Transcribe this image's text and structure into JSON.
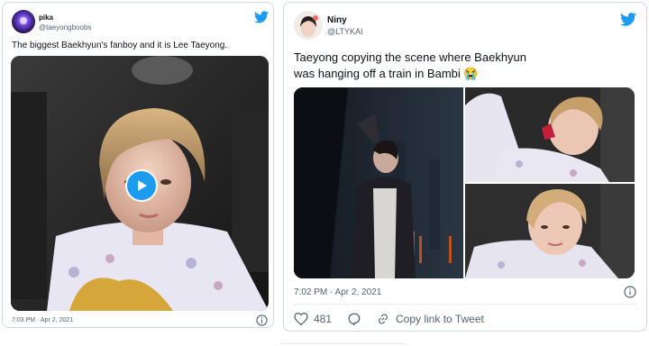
{
  "colors": {
    "accent": "#1d9bf0",
    "border": "#cfd9de",
    "muted": "#536471",
    "heart": "#536471"
  },
  "tweet1": {
    "display_name": "pika",
    "username": "@taeyongboobs",
    "text": "The biggest Baekhyun's fanboy and it is Lee Taeyong.",
    "timestamp": "7:03 PM · Apr 2, 2021",
    "icons": [
      "twitter-bird-icon",
      "play-icon",
      "info-icon"
    ]
  },
  "tweet2": {
    "display_name": "Niny",
    "username": "@LTYKAI",
    "text": "Taeyong copying the scene where Baekhyun was hanging off a train in Bambi 😭",
    "timestamp": "7:02 PM · Apr 2, 2021",
    "likes": "481",
    "copy_link_label": "Copy link to Tweet",
    "icons": [
      "twitter-bird-icon",
      "info-icon",
      "heart-icon",
      "reply-icon",
      "link-icon"
    ]
  }
}
